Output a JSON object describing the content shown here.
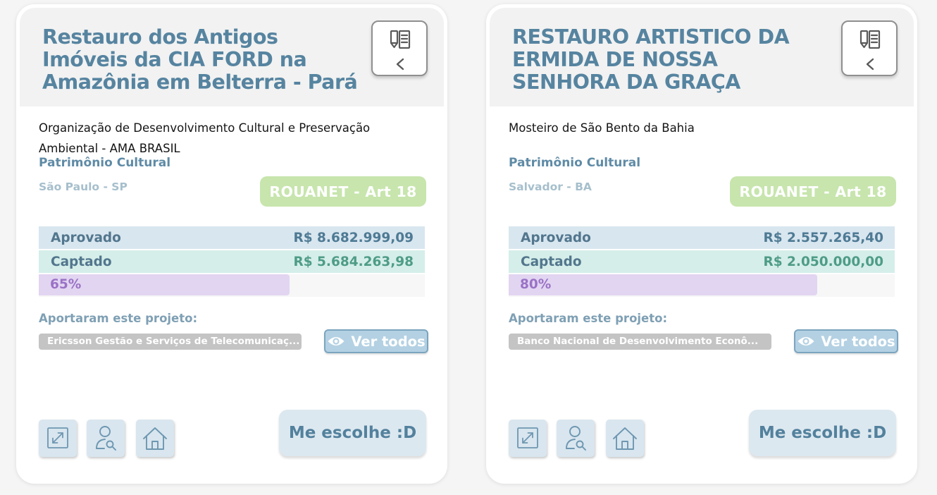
{
  "cards": [
    {
      "title": "Restauro dos Antigos Imóveis da CIA FORD na Amazônia em Belterra - Pará",
      "proponent": "Organização de Desenvolvimento Cultural e Preservação Ambiental - AMA BRASIL",
      "area": "Patrimônio Cultural",
      "location": "São Paulo - SP",
      "law": "ROUANET - Art 18",
      "approved_label": "Aprovado",
      "approved_value": "R$ 8.682.999,09",
      "captured_label": "Captado",
      "captured_value": "R$ 5.684.263,98",
      "progress_label": "65%",
      "progress": 65,
      "sponsors_label": "Aportaram este projeto:",
      "sponsor": "Ericsson Gestão e Serviços de Telecomunicaç...",
      "see_all": "Ver todos",
      "choose": "Me escolhe :D",
      "icons": [
        "bookmark-icon",
        "chevron-left-icon",
        "eye-icon",
        "expand-icon",
        "user-search-icon",
        "home-icon"
      ]
    },
    {
      "title": "RESTAURO ARTISTICO DA ERMIDA DE NOSSA SENHORA DA GRAÇA",
      "proponent": "Mosteiro de São Bento da Bahia",
      "area": "Patrimônio Cultural",
      "location": "Salvador - BA",
      "law": "ROUANET - Art 18",
      "approved_label": "Aprovado",
      "approved_value": "R$ 2.557.265,40",
      "captured_label": "Captado",
      "captured_value": "R$ 2.050.000,00",
      "progress_label": "80%",
      "progress": 80,
      "sponsors_label": "Aportaram este projeto:",
      "sponsor": "Banco Nacional de Desenvolvimento Econô...",
      "see_all": "Ver todos",
      "choose": "Me escolhe :D",
      "icons": [
        "bookmark-icon",
        "chevron-left-icon",
        "eye-icon",
        "expand-icon",
        "user-search-icon",
        "home-icon"
      ]
    }
  ],
  "colors": {
    "title": "#5684a0",
    "law_badge": "#c7e5ad",
    "approved_bg": "#d8e6ef",
    "captured_bg": "#d5eee9",
    "progress_fill": "#e2d5f1",
    "progress_text": "#9a72c6",
    "button_bg": "#d9e6ef"
  }
}
